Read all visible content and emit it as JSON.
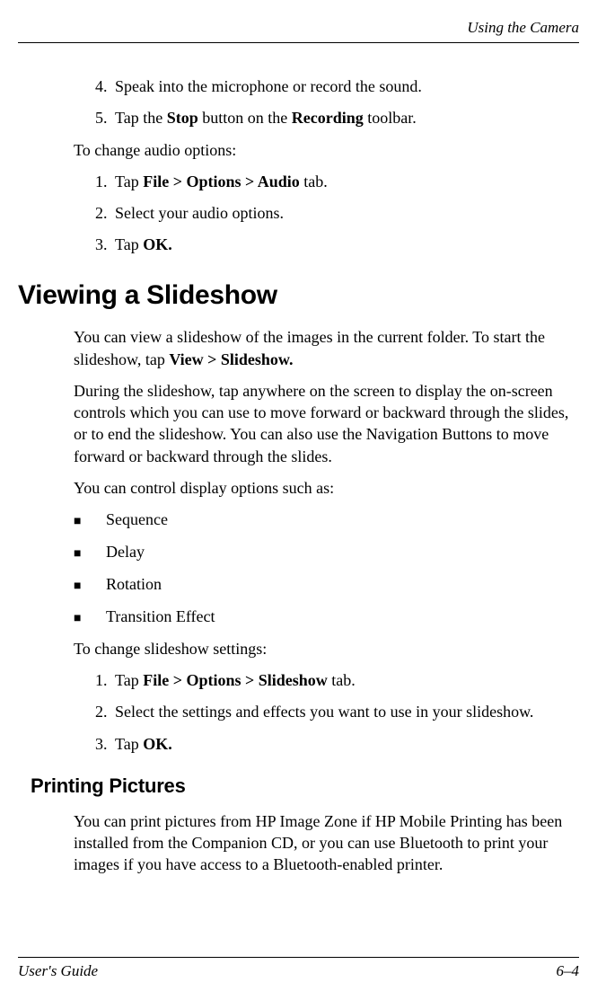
{
  "header": {
    "section_title": "Using the Camera"
  },
  "body": {
    "steps_a": [
      {
        "num": "4.",
        "pre": "Speak into the microphone or record the sound.",
        "bold": "",
        "post": ""
      },
      {
        "num": "5.",
        "pre": "Tap the ",
        "bold1": "Stop",
        "mid": " button on the ",
        "bold2": "Recording",
        "post": " toolbar."
      }
    ],
    "para_change_audio": "To change audio options:",
    "steps_b": [
      {
        "num": "1.",
        "pre": "Tap ",
        "bold": "File > Options > Audio",
        "post": " tab."
      },
      {
        "num": "2.",
        "pre": "Select your audio options.",
        "bold": "",
        "post": ""
      },
      {
        "num": "3.",
        "pre": "Tap ",
        "bold": "OK.",
        "post": ""
      }
    ],
    "h1_viewing": "Viewing a Slideshow",
    "para_view1_pre": "You can view a slideshow of the images in the current folder. To start the slideshow, tap ",
    "para_view1_bold": "View > Slideshow.",
    "para_view2": "During the slideshow, tap anywhere on the screen to display the on-screen controls which you can use to move forward or backward through the slides, or to end the slideshow. You can also use the Navigation Buttons to move forward or backward through the slides.",
    "para_view3": "You can control display options such as:",
    "bullets": [
      "Sequence",
      "Delay",
      "Rotation",
      "Transition Effect"
    ],
    "para_change_slideshow": "To change slideshow settings:",
    "steps_c": [
      {
        "num": "1.",
        "pre": "Tap ",
        "bold": "File > Options > Slideshow",
        "post": " tab."
      },
      {
        "num": "2.",
        "pre": "Select the settings and effects you want to use in your slideshow.",
        "bold": "",
        "post": ""
      },
      {
        "num": "3.",
        "pre": "Tap ",
        "bold": "OK.",
        "post": ""
      }
    ],
    "h2_printing": "Printing Pictures",
    "para_print": "You can print pictures from HP Image Zone if HP Mobile Printing has been installed from the Companion CD, or you can use Bluetooth to print your images if you have access to a Bluetooth-enabled printer."
  },
  "footer": {
    "left": "User's Guide",
    "right": "6–4"
  }
}
